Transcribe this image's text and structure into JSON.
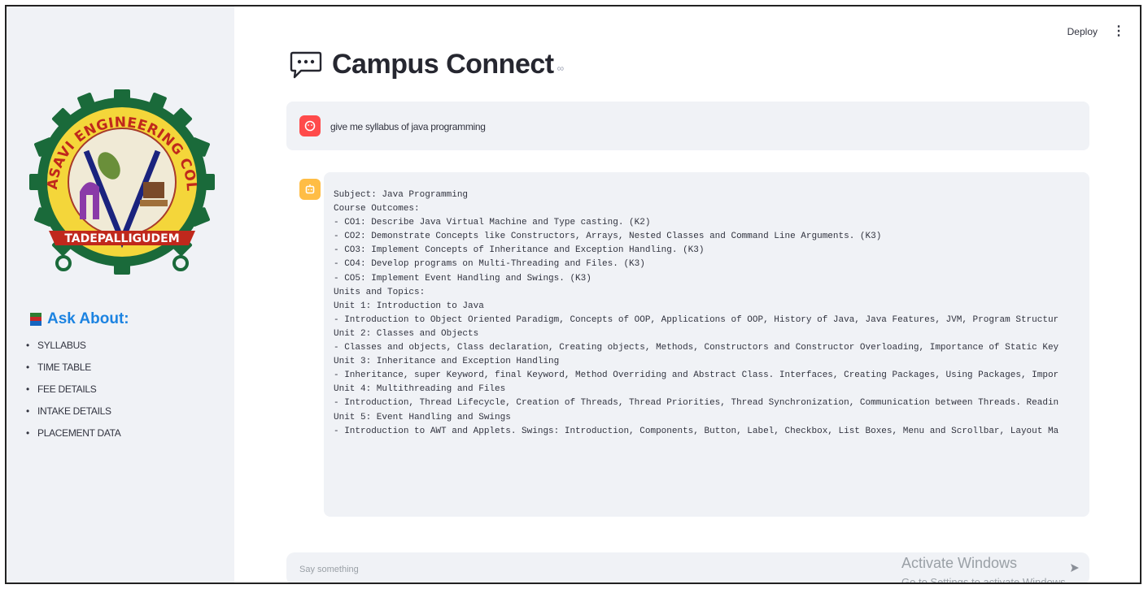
{
  "sidebar": {
    "logo": {
      "top_text": "SRI VASAVI ENGINEERING COLLEGE",
      "banner_text": "TADEPALLIGUDEM"
    },
    "ask_title": "Ask About:",
    "items": [
      "SYLLABUS",
      "TIME TABLE",
      "FEE DETAILS",
      "INTAKE DETAILS",
      "PLACEMENT DATA"
    ]
  },
  "topbar": {
    "deploy_label": "Deploy",
    "menu_icon": "vertical-dots-icon"
  },
  "main": {
    "title": "Campus Connect",
    "title_icon": "chat-bubble-icon",
    "link_icon_glyph": "∞"
  },
  "messages": {
    "user": "give me syllabus of java programming",
    "assistant": "Subject: Java Programming\nCourse Outcomes:\n- CO1: Describe Java Virtual Machine and Type casting. (K2)\n- CO2: Demonstrate Concepts like Constructors, Arrays, Nested Classes and Command Line Arguments. (K3)\n- CO3: Implement Concepts of Inheritance and Exception Handling. (K3)\n- CO4: Develop programs on Multi-Threading and Files. (K3)\n- CO5: Implement Event Handling and Swings. (K3)\nUnits and Topics:\nUnit 1: Introduction to Java\n- Introduction to Object Oriented Paradigm, Concepts of OOP, Applications of OOP, History of Java, Java Features, JVM, Program Structur\nUnit 2: Classes and Objects\n- Classes and objects, Class declaration, Creating objects, Methods, Constructors and Constructor Overloading, Importance of Static Key\nUnit 3: Inheritance and Exception Handling\n- Inheritance, super Keyword, final Keyword, Method Overriding and Abstract Class. Interfaces, Creating Packages, Using Packages, Impor\nUnit 4: Multithreading and Files\n- Introduction, Thread Lifecycle, Creation of Threads, Thread Priorities, Thread Synchronization, Communication between Threads. Readin\nUnit 5: Event Handling and Swings\n- Introduction to AWT and Applets. Swings: Introduction, Components, Button, Label, Checkbox, List Boxes, Menu and Scrollbar, Layout Ma"
  },
  "chat_input": {
    "placeholder": "Say something",
    "send_icon": "send-arrow-icon"
  },
  "watermark": {
    "line1": "Activate Windows",
    "line2": "Go to Settings to activate Windows."
  },
  "colors": {
    "accent": "#1c83e1",
    "user_avatar": "#ff4b4b",
    "bot_avatar": "#ffbd45",
    "panel": "#f0f2f6"
  }
}
